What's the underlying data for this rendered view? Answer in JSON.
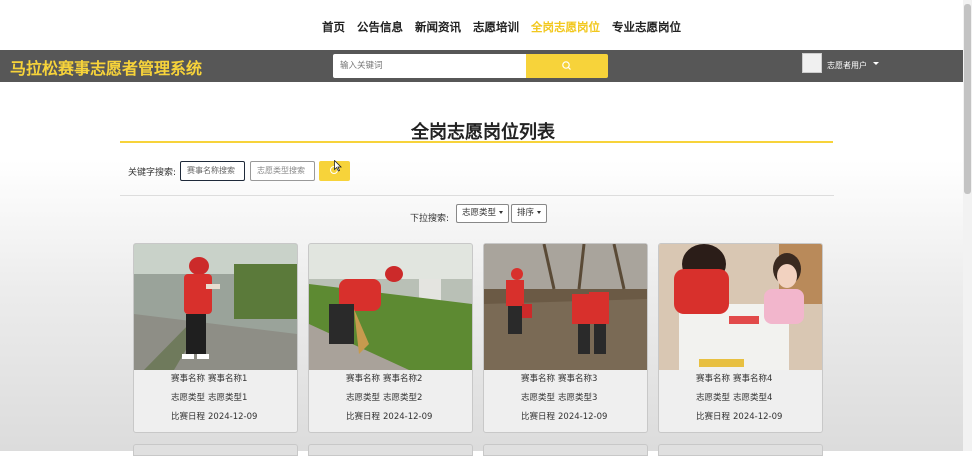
{
  "nav": {
    "items": [
      {
        "label": "首页"
      },
      {
        "label": "公告信息"
      },
      {
        "label": "新闻资讯"
      },
      {
        "label": "志愿培训"
      },
      {
        "label": "全岗志愿岗位",
        "active": true
      },
      {
        "label": "专业志愿岗位"
      }
    ]
  },
  "header": {
    "site_title": "马拉松赛事志愿者管理系统",
    "search_placeholder": "输入关键词",
    "search_icon": "search-icon",
    "username": "志愿者用户"
  },
  "main": {
    "title": "全岗志愿岗位列表",
    "keyword_label": "关键字搜索:",
    "event_name_placeholder": "赛事名称搜索",
    "volunteer_type_placeholder": "志愿类型搜索",
    "dropdown_label": "下拉搜索:",
    "dropdown_type": "志愿类型",
    "dropdown_sort": "排序"
  },
  "colors": {
    "accent": "#f7d33a",
    "header_bg": "#575757"
  },
  "cards": [
    {
      "event_label": "赛事名称",
      "event_name": "赛事名称1",
      "type_label": "志愿类型",
      "type": "志愿类型1",
      "date_label": "比赛日程",
      "date": "2024-12-09"
    },
    {
      "event_label": "赛事名称",
      "event_name": "赛事名称2",
      "type_label": "志愿类型",
      "type": "志愿类型2",
      "date_label": "比赛日程",
      "date": "2024-12-09"
    },
    {
      "event_label": "赛事名称",
      "event_name": "赛事名称3",
      "type_label": "志愿类型",
      "type": "志愿类型3",
      "date_label": "比赛日程",
      "date": "2024-12-09"
    },
    {
      "event_label": "赛事名称",
      "event_name": "赛事名称4",
      "type_label": "志愿类型",
      "type": "志愿类型4",
      "date_label": "比赛日程",
      "date": "2024-12-09"
    }
  ]
}
